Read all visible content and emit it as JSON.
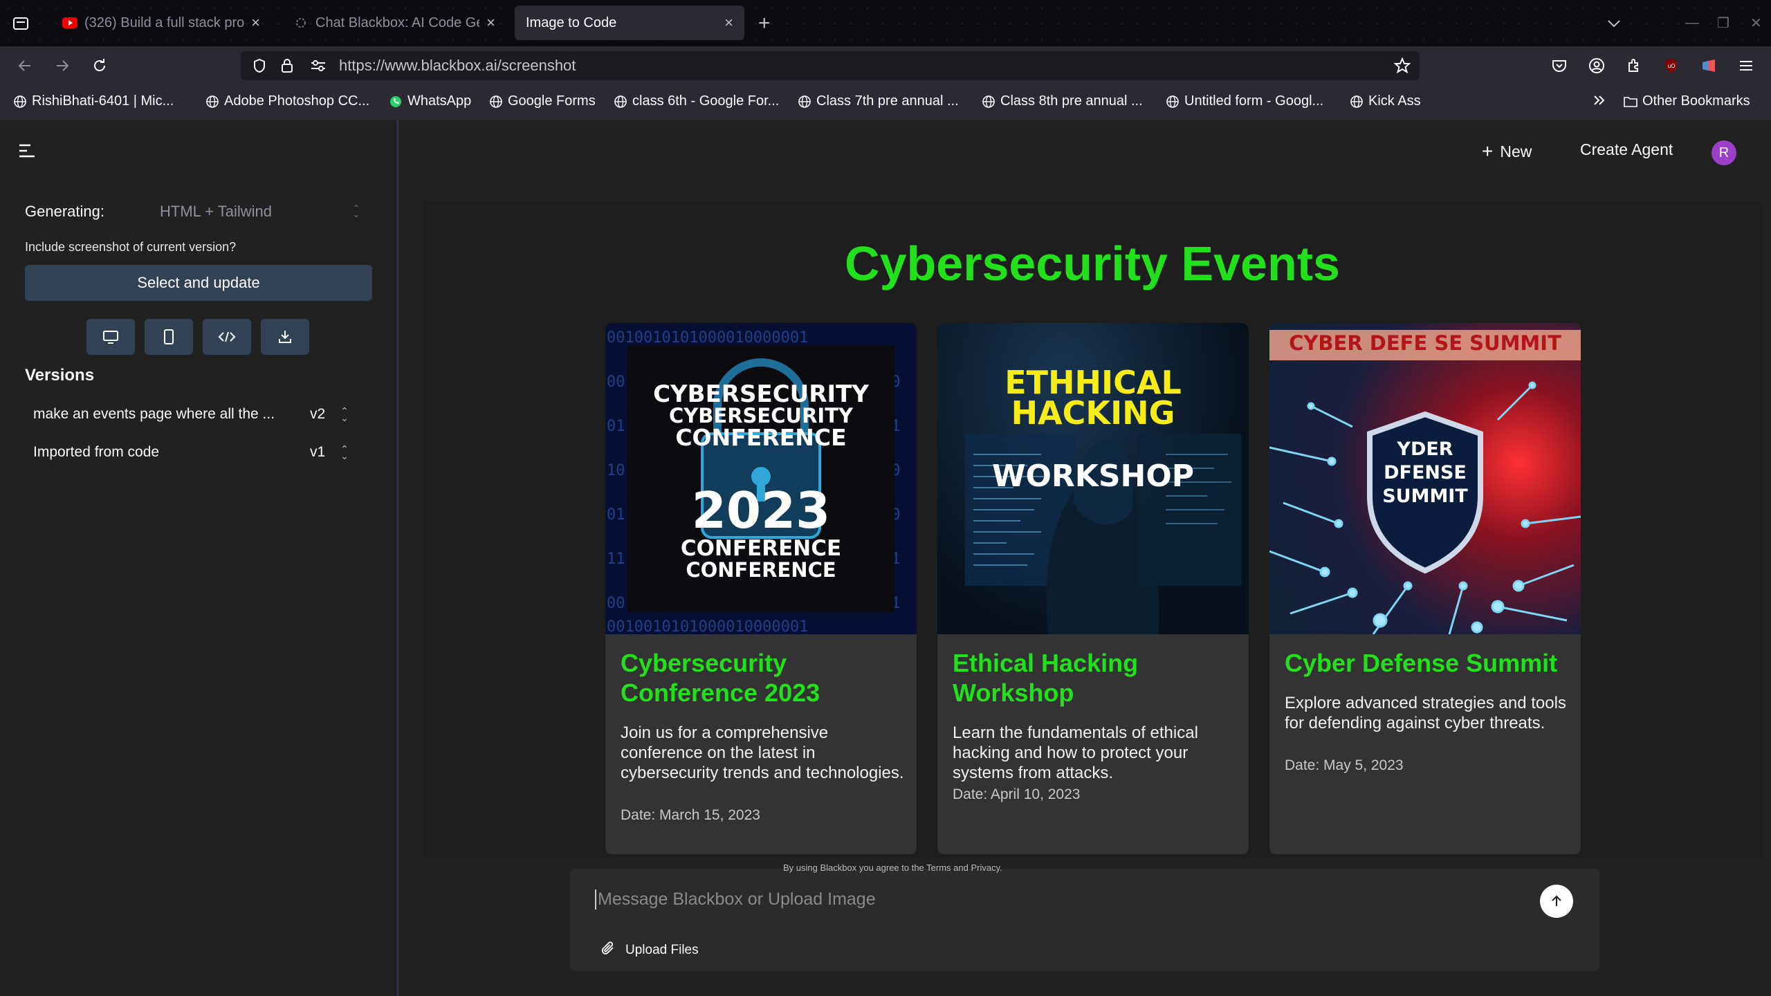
{
  "browser": {
    "tabs": [
      {
        "title": "(326) Build a full stack proj",
        "favicon": "youtube-icon",
        "active": false
      },
      {
        "title": "Chat Blackbox: AI Code Ge",
        "favicon": "blackbox-icon",
        "active": false
      },
      {
        "title": "Image to Code",
        "favicon": "",
        "active": true
      }
    ],
    "url": {
      "host": "https://www.blackbox.ai",
      "path": "/screenshot"
    },
    "bookmarks": [
      "RishiBhati-6401 | Mic...",
      "Adobe Photoshop CC...",
      "WhatsApp",
      "Google Forms",
      "class 6th - Google For...",
      "Class 7th pre annual ...",
      "Class 8th pre annual ...",
      "Untitled form - Googl...",
      "Kick Ass"
    ],
    "other_bookmarks": "Other Bookmarks"
  },
  "sidebar": {
    "generating_label": "Generating:",
    "generating_value": "HTML + Tailwind",
    "include_question": "Include screenshot of current version?",
    "select_update": "Select and update",
    "versions_title": "Versions",
    "versions": [
      {
        "name": "make an events page where all the ...",
        "tag": "v2"
      },
      {
        "name": "Imported from code",
        "tag": "v1"
      }
    ]
  },
  "header": {
    "new_label": "New",
    "create_agent": "Create Agent",
    "avatar_letter": "R"
  },
  "preview": {
    "title": "Cybersecurity Events",
    "events": [
      {
        "title": "Cybersecurity Conference 2023",
        "description": "Join us for a comprehensive conference on the latest in cybersecurity trends and technologies.",
        "date": "Date: March 15, 2023",
        "poster": {
          "line1": "CYBERSECURITY",
          "line2": "CYBERSECURITY",
          "line3": "CONFERENCE",
          "year": "2023",
          "line4": "CONFERENCE",
          "line5": "CONFERENCE"
        }
      },
      {
        "title": "Ethical Hacking Workshop",
        "description": "Learn the fundamentals of ethical hacking and how to protect your systems from attacks.",
        "date": "Date: April 10, 2023",
        "poster": {
          "line1": "ETHHICAL",
          "line2": "HACKING",
          "line3": "WORKSHOP"
        }
      },
      {
        "title": "Cyber Defense Summit",
        "description": "Explore advanced strategies and tools for defending against cyber threats.",
        "date": "Date: May 5, 2023",
        "poster": {
          "banner": "CYBER DEFE SE SUMMIT",
          "shield1": "YDER",
          "shield2": "DFENSE",
          "shield3": "SUMMIT"
        }
      }
    ]
  },
  "chat": {
    "placeholder": "Message Blackbox or Upload Image",
    "upload_label": "Upload Files",
    "terms": "By using Blackbox you agree to the Terms and Privacy."
  },
  "colors": {
    "accent_green": "#22e11c",
    "button_slate": "#334155",
    "avatar_purple": "#9b3fc9"
  }
}
